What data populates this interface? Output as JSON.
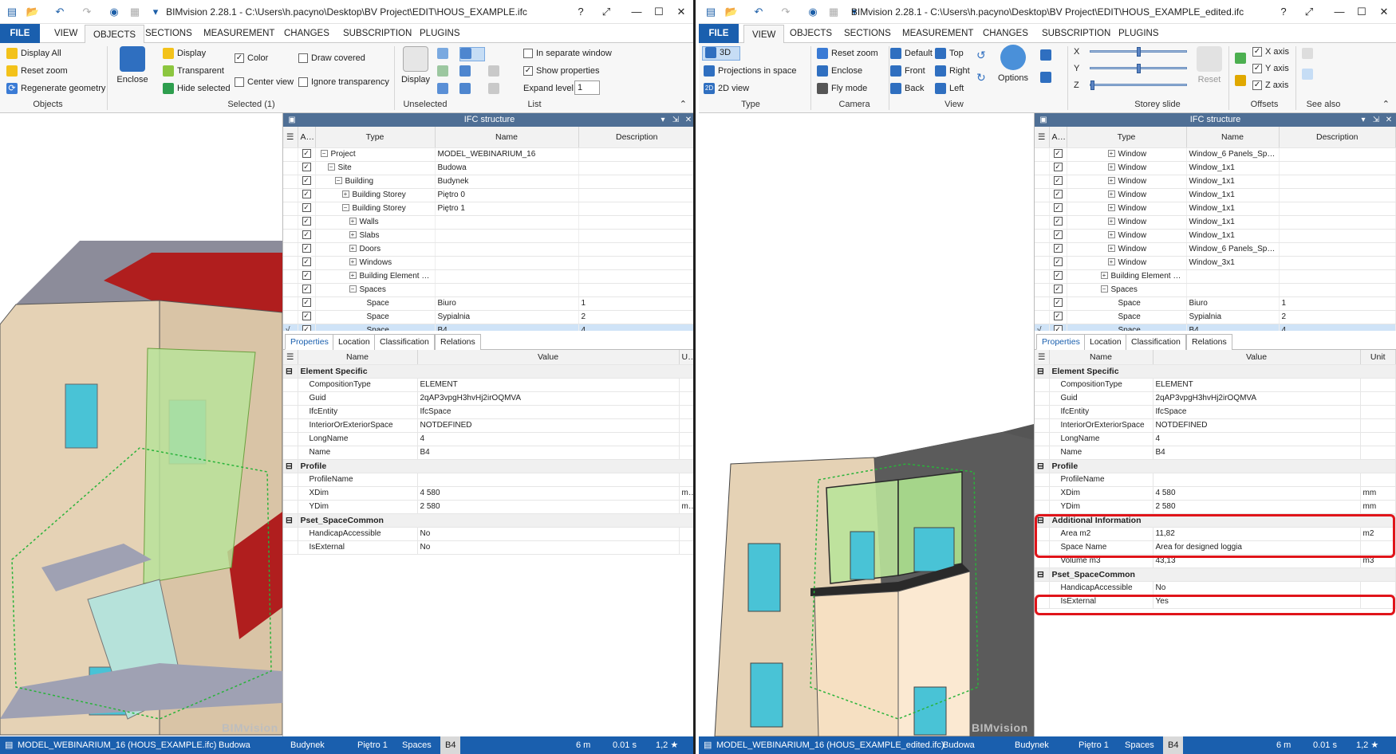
{
  "left": {
    "title": "BIMvision 2.28.1 - C:\\Users\\h.pacyno\\Desktop\\BV Project\\EDIT\\HOUS_EXAMPLE.ifc",
    "tabs": [
      "FILE",
      "VIEW",
      "OBJECTS",
      "SECTIONS",
      "MEASUREMENT",
      "CHANGES",
      "SUBSCRIPTION",
      "PLUGINS"
    ],
    "active_tab": "OBJECTS",
    "ribbon": {
      "display_all": "Display All",
      "reset_zoom": "Reset zoom",
      "regen": "Regenerate geometry",
      "objects_group": "Objects",
      "enclose": "Enclose",
      "display": "Display",
      "transparent": "Transparent",
      "hide_selected": "Hide selected",
      "color": "Color",
      "center_view": "Center view",
      "draw_covered": "Draw covered",
      "ignore_transparency": "Ignore transparency",
      "selected_group": "Selected (1)",
      "display2": "Display",
      "unselected_group": "Unselected",
      "separate_window": "In separate window",
      "show_properties": "Show properties",
      "expand_level": "Expand level",
      "expand_value": "1",
      "list_group": "List"
    },
    "ifc_title": "IFC structure",
    "tree_headers": [
      "Acti ve",
      "Type",
      "Name",
      "Description"
    ],
    "tree": [
      {
        "type": "Project",
        "name": "MODEL_WEBINARIUM_16",
        "desc": "",
        "indent": 0,
        "exp": "−"
      },
      {
        "type": "Site",
        "name": "Budowa",
        "desc": "",
        "indent": 1,
        "exp": "−"
      },
      {
        "type": "Building",
        "name": "Budynek",
        "desc": "",
        "indent": 2,
        "exp": "−"
      },
      {
        "type": "Building Storey",
        "name": "Piętro 0",
        "desc": "",
        "indent": 3,
        "exp": "+"
      },
      {
        "type": "Building Storey",
        "name": "Piętro 1",
        "desc": "",
        "indent": 3,
        "exp": "−"
      },
      {
        "type": "Walls",
        "name": "",
        "desc": "",
        "indent": 4,
        "exp": "+"
      },
      {
        "type": "Slabs",
        "name": "",
        "desc": "",
        "indent": 4,
        "exp": "+"
      },
      {
        "type": "Doors",
        "name": "",
        "desc": "",
        "indent": 4,
        "exp": "+"
      },
      {
        "type": "Windows",
        "name": "",
        "desc": "",
        "indent": 4,
        "exp": "+"
      },
      {
        "type": "Building Element Pr…",
        "name": "",
        "desc": "",
        "indent": 4,
        "exp": "+"
      },
      {
        "type": "Spaces",
        "name": "",
        "desc": "",
        "indent": 4,
        "exp": "−"
      },
      {
        "type": "Space",
        "name": "Biuro",
        "desc": "1",
        "indent": 5,
        "exp": ""
      },
      {
        "type": "Space",
        "name": "Sypialnia",
        "desc": "2",
        "indent": 5,
        "exp": ""
      },
      {
        "type": "Space",
        "name": "B4",
        "desc": "4",
        "indent": 5,
        "exp": "",
        "sel": true
      }
    ],
    "prop_tabs": [
      "Properties",
      "Location",
      "Classification",
      "Relations"
    ],
    "prop_headers": [
      "Name",
      "Value",
      "Unit"
    ],
    "props": [
      {
        "cat": "Element Specific"
      },
      {
        "n": "CompositionType",
        "v": "ELEMENT",
        "u": ""
      },
      {
        "n": "Guid",
        "v": "2qAP3vpgH3hvHj2irOQMVA",
        "u": ""
      },
      {
        "n": "IfcEntity",
        "v": "IfcSpace",
        "u": ""
      },
      {
        "n": "InteriorOrExteriorSpace",
        "v": "NOTDEFINED",
        "u": ""
      },
      {
        "n": "LongName",
        "v": "4",
        "u": ""
      },
      {
        "n": "Name",
        "v": "B4",
        "u": ""
      },
      {
        "cat": "Profile"
      },
      {
        "n": "ProfileName",
        "v": "",
        "u": ""
      },
      {
        "n": "XDim",
        "v": "4 580",
        "u": "mm"
      },
      {
        "n": "YDim",
        "v": "2 580",
        "u": "mm"
      },
      {
        "cat": "Pset_SpaceCommon"
      },
      {
        "n": "HandicapAccessible",
        "v": "No",
        "u": ""
      },
      {
        "n": "IsExternal",
        "v": "No",
        "u": ""
      }
    ],
    "status": {
      "model": "MODEL_WEBINARIUM_16 (HOUS_EXAMPLE.ifc)",
      "site": "Budowa",
      "building": "Budynek",
      "storey": "Piętro 1",
      "spaces": "Spaces",
      "space": "B4",
      "dist": "6 m",
      "time": "0.01 s",
      "zoom": "1,2 ★"
    },
    "watermark": "BIMvision"
  },
  "right": {
    "title": "BIMvision 2.28.1 - C:\\Users\\h.pacyno\\Desktop\\BV Project\\EDIT\\HOUS_EXAMPLE_edited.ifc",
    "tabs": [
      "FILE",
      "VIEW",
      "OBJECTS",
      "SECTIONS",
      "MEASUREMENT",
      "CHANGES",
      "SUBSCRIPTION",
      "PLUGINS"
    ],
    "active_tab": "VIEW",
    "ribbon": {
      "btn_3d": "3D",
      "projections": "Projections in space",
      "view2d": "2D view",
      "type_group": "Type",
      "reset_zoom": "Reset zoom",
      "enclose": "Enclose",
      "fly_mode": "Fly mode",
      "camera_group": "Camera",
      "default": "Default",
      "front": "Front",
      "back": "Back",
      "top": "Top",
      "right": "Right",
      "left": "Left",
      "options": "Options",
      "view_group": "View",
      "x": "X",
      "y": "Y",
      "z": "Z",
      "reset": "Reset",
      "storey_group": "Storey slide",
      "x_axis": "X axis",
      "y_axis": "Y axis",
      "z_axis": "Z axis",
      "offsets_group": "Offsets",
      "see_also": "See also"
    },
    "ifc_title": "IFC structure",
    "tree_headers": [
      "Acti ve",
      "Type",
      "Name",
      "Description"
    ],
    "tree": [
      {
        "type": "Window",
        "name": "Window_6 Panels_Spe…",
        "desc": "",
        "indent": 5,
        "exp": "+"
      },
      {
        "type": "Window",
        "name": "Window_1x1",
        "desc": "",
        "indent": 5,
        "exp": "+"
      },
      {
        "type": "Window",
        "name": "Window_1x1",
        "desc": "",
        "indent": 5,
        "exp": "+"
      },
      {
        "type": "Window",
        "name": "Window_1x1",
        "desc": "",
        "indent": 5,
        "exp": "+"
      },
      {
        "type": "Window",
        "name": "Window_1x1",
        "desc": "",
        "indent": 5,
        "exp": "+"
      },
      {
        "type": "Window",
        "name": "Window_1x1",
        "desc": "",
        "indent": 5,
        "exp": "+"
      },
      {
        "type": "Window",
        "name": "Window_1x1",
        "desc": "",
        "indent": 5,
        "exp": "+"
      },
      {
        "type": "Window",
        "name": "Window_6 Panels_Spe…",
        "desc": "",
        "indent": 5,
        "exp": "+"
      },
      {
        "type": "Window",
        "name": "Window_3x1",
        "desc": "",
        "indent": 5,
        "exp": "+"
      },
      {
        "type": "Building Element Pr…",
        "name": "",
        "desc": "",
        "indent": 4,
        "exp": "+"
      },
      {
        "type": "Spaces",
        "name": "",
        "desc": "",
        "indent": 4,
        "exp": "−"
      },
      {
        "type": "Space",
        "name": "Biuro",
        "desc": "1",
        "indent": 5,
        "exp": ""
      },
      {
        "type": "Space",
        "name": "Sypialnia",
        "desc": "2",
        "indent": 5,
        "exp": ""
      },
      {
        "type": "Space",
        "name": "B4",
        "desc": "4",
        "indent": 5,
        "exp": "",
        "sel": true
      }
    ],
    "prop_tabs": [
      "Properties",
      "Location",
      "Classification",
      "Relations"
    ],
    "prop_headers": [
      "Name",
      "Value",
      "Unit"
    ],
    "props": [
      {
        "cat": "Element Specific"
      },
      {
        "n": "CompositionType",
        "v": "ELEMENT",
        "u": ""
      },
      {
        "n": "Guid",
        "v": "2qAP3vpgH3hvHj2irOQMVA",
        "u": ""
      },
      {
        "n": "IfcEntity",
        "v": "IfcSpace",
        "u": ""
      },
      {
        "n": "InteriorOrExteriorSpace",
        "v": "NOTDEFINED",
        "u": ""
      },
      {
        "n": "LongName",
        "v": "4",
        "u": ""
      },
      {
        "n": "Name",
        "v": "B4",
        "u": ""
      },
      {
        "cat": "Profile"
      },
      {
        "n": "ProfileName",
        "v": "",
        "u": ""
      },
      {
        "n": "XDim",
        "v": "4 580",
        "u": "mm"
      },
      {
        "n": "YDim",
        "v": "2 580",
        "u": "mm"
      },
      {
        "cat": "Additional Information"
      },
      {
        "n": "Area m2",
        "v": "11,82",
        "u": "m2"
      },
      {
        "n": "Space Name",
        "v": "Area for designed loggia",
        "u": ""
      },
      {
        "n": "Volume m3",
        "v": "43,13",
        "u": "m3"
      },
      {
        "cat": "Pset_SpaceCommon"
      },
      {
        "n": "HandicapAccessible",
        "v": "No",
        "u": ""
      },
      {
        "n": "IsExternal",
        "v": "Yes",
        "u": ""
      }
    ],
    "status": {
      "model": "MODEL_WEBINARIUM_16 (HOUS_EXAMPLE_edited.ifc)",
      "site": "Budowa",
      "building": "Budynek",
      "storey": "Piętro 1",
      "spaces": "Spaces",
      "space": "B4",
      "dist": "6 m",
      "time": "0.01 s",
      "zoom": "1,2 ★"
    },
    "watermark": "BIMvision"
  },
  "colors": {
    "accent": "#1a5fae",
    "highlight": "#e0141a",
    "roof": "#b01e1e",
    "wall": "#e5d2b5",
    "glass": "#49c3d6",
    "space": "#b9e39a"
  }
}
